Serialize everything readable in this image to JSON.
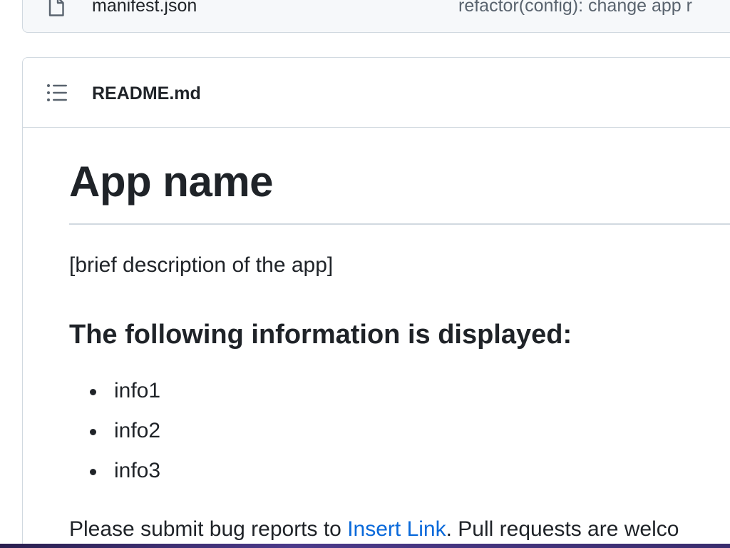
{
  "file_list": {
    "row": {
      "icon": "file-icon",
      "name": "manifest.json",
      "commit_message": "refactor(config): change app r"
    }
  },
  "readme": {
    "header": {
      "toc_icon": "list-unordered-icon",
      "title": "README.md"
    },
    "body": {
      "h1": "App name",
      "description": "[brief description of the app]",
      "h3": "The following information is displayed:",
      "list_items": [
        "info1",
        "info2",
        "info3"
      ],
      "paragraph": {
        "prefix": "Please submit bug reports to ",
        "link_text": "Insert Link",
        "suffix": ". Pull requests are welco"
      }
    }
  },
  "colors": {
    "text": "#1f2328",
    "muted": "#59636e",
    "link": "#0969da",
    "border": "#d1d9e0"
  }
}
